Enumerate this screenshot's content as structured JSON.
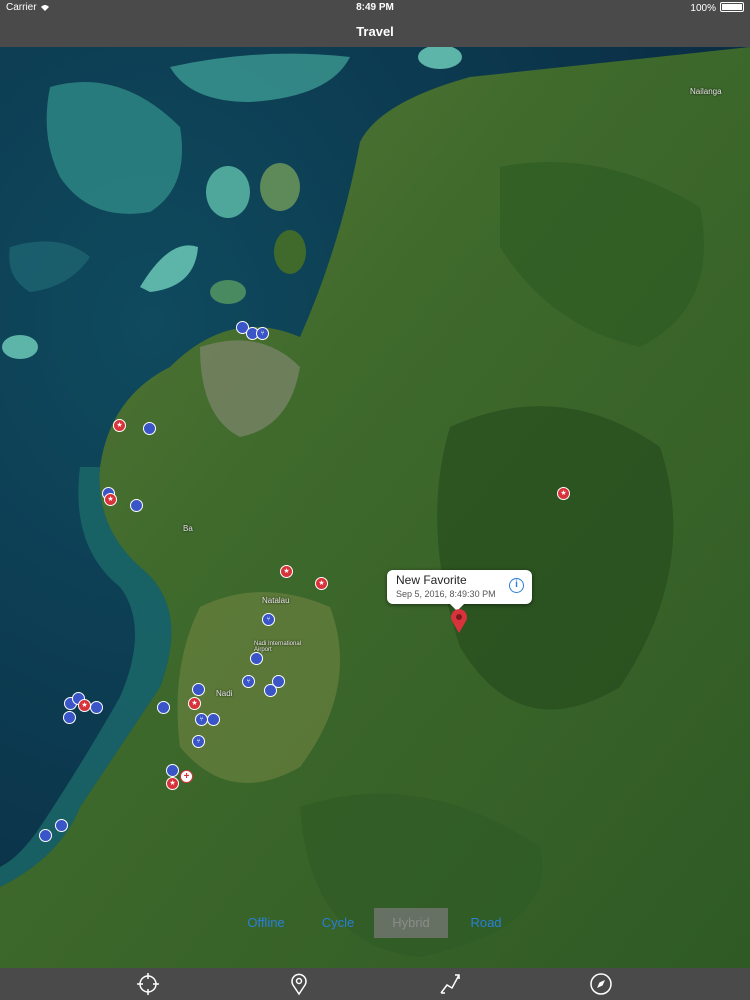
{
  "status_bar": {
    "carrier": "Carrier",
    "time": "8:49 PM",
    "battery": "100%"
  },
  "nav": {
    "title": "Travel"
  },
  "map": {
    "towns": [
      "Nailanga",
      "Ba",
      "Natalau",
      "Nadi International Airport",
      "Nadi"
    ],
    "callout": {
      "title": "New Favorite",
      "subtitle": "Sep 5, 2016, 8:49:30 PM",
      "info_icon": "info-icon"
    }
  },
  "map_type": {
    "options": [
      "Offline",
      "Cycle",
      "Hybrid",
      "Road"
    ],
    "selected": "Hybrid"
  },
  "tabs": [
    "crosshair-icon",
    "pin-icon",
    "route-icon",
    "compass-icon"
  ],
  "colors": {
    "bar": "#4a4a4a",
    "accent": "#2a7fd6",
    "poi_blue": "#3a55c8",
    "poi_red": "#d8333a"
  }
}
